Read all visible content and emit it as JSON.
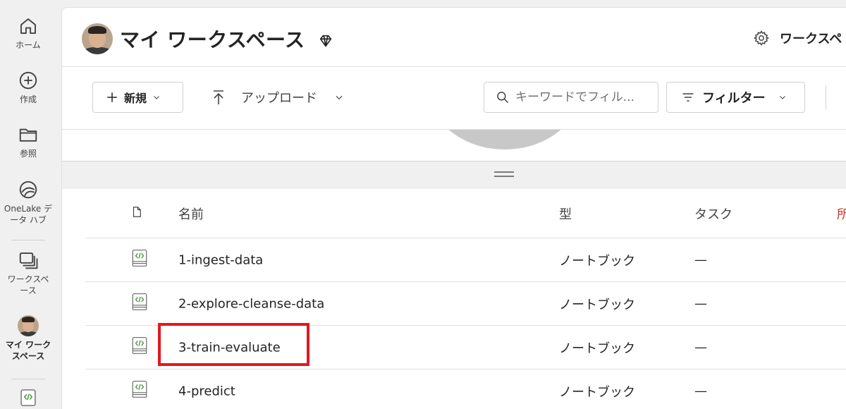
{
  "rail": {
    "items": [
      {
        "label": "ホーム",
        "icon": "home-icon"
      },
      {
        "label": "作成",
        "icon": "plus-circle-icon"
      },
      {
        "label": "参照",
        "icon": "folder-icon"
      },
      {
        "label": "OneLake デ\nータ ハブ",
        "icon": "onelake-icon"
      },
      {
        "label": "ワークスペ\nース",
        "icon": "workspaces-icon"
      },
      {
        "label": "マイ ワーク\nスペース",
        "icon": "avatar"
      }
    ]
  },
  "header": {
    "title": "マイ ワークスペース",
    "settings_label": "ワークスペ"
  },
  "toolbar": {
    "new_label": "新規",
    "upload_label": "アップロード",
    "search_placeholder": "キーワードでフィル...",
    "filter_label": "フィルター"
  },
  "table": {
    "columns": {
      "name": "名前",
      "type": "型",
      "task": "タスク",
      "extra": "所"
    },
    "rows": [
      {
        "name": "1-ingest-data",
        "type": "ノートブック",
        "task": "—"
      },
      {
        "name": "2-explore-cleanse-data",
        "type": "ノートブック",
        "task": "—"
      },
      {
        "name": "3-train-evaluate",
        "type": "ノートブック",
        "task": "—"
      },
      {
        "name": "4-predict",
        "type": "ノートブック",
        "task": "—"
      }
    ]
  },
  "colors": {
    "highlight": "#e0191e",
    "notebook_green": "#4a9a3d"
  }
}
